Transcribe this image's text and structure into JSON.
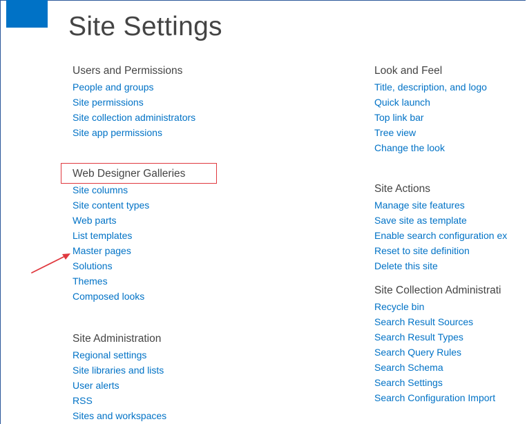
{
  "page": {
    "title": "Site Settings"
  },
  "colors": {
    "link": "#0072c6",
    "heading": "#444444",
    "brand_tile": "#0072c6",
    "annotation": "#e0383e"
  },
  "sections": {
    "users_permissions": {
      "heading": "Users and Permissions",
      "links": [
        "People and groups",
        "Site permissions",
        "Site collection administrators",
        "Site app permissions"
      ]
    },
    "web_designer_galleries": {
      "heading": "Web Designer Galleries",
      "links": [
        "Site columns",
        "Site content types",
        "Web parts",
        "List templates",
        "Master pages",
        "Solutions",
        "Themes",
        "Composed looks"
      ]
    },
    "site_administration": {
      "heading": "Site Administration",
      "links": [
        "Regional settings",
        "Site libraries and lists",
        "User alerts",
        "RSS",
        "Sites and workspaces"
      ]
    },
    "look_and_feel": {
      "heading": "Look and Feel",
      "links": [
        "Title, description, and logo",
        "Quick launch",
        "Top link bar",
        "Tree view",
        "Change the look"
      ]
    },
    "site_actions": {
      "heading": "Site Actions",
      "links": [
        "Manage site features",
        "Save site as template",
        "Enable search configuration ex",
        "Reset to site definition",
        "Delete this site"
      ]
    },
    "site_collection_administration": {
      "heading": "Site Collection Administrati",
      "links": [
        "Recycle bin",
        "Search Result Sources",
        "Search Result Types",
        "Search Query Rules",
        "Search Schema",
        "Search Settings",
        "Search Configuration Import"
      ]
    }
  },
  "annotations": {
    "highlight_target": "Web Designer Galleries",
    "arrow_target": "Solutions"
  }
}
